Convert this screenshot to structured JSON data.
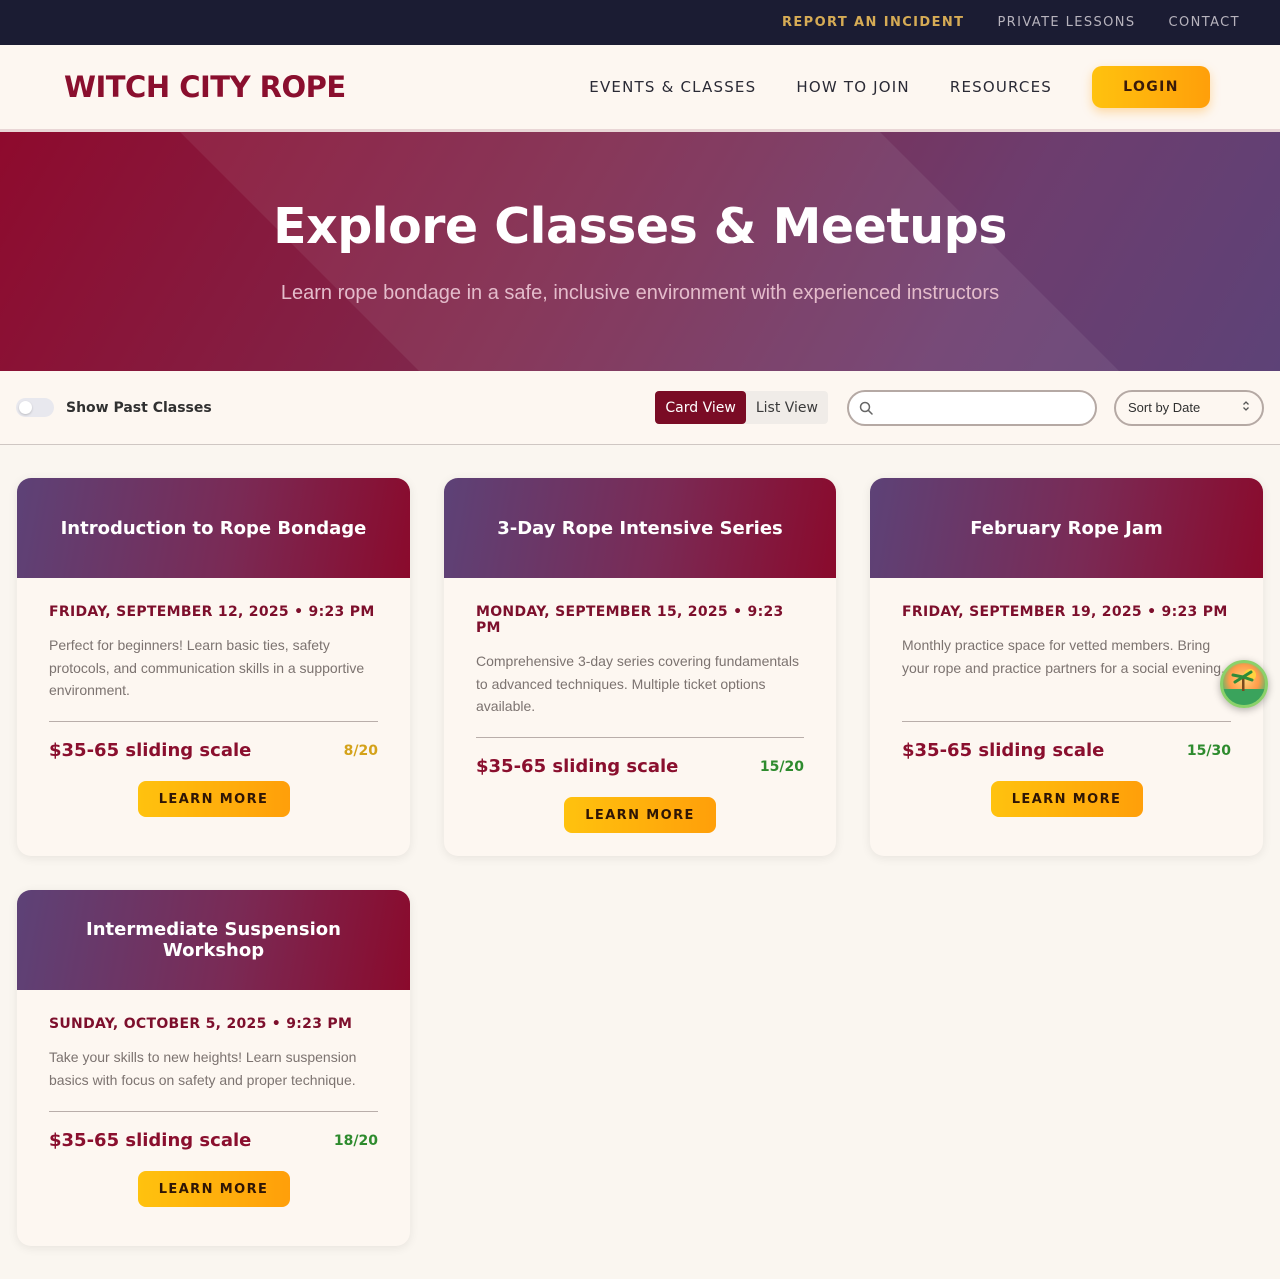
{
  "utility_nav": {
    "report": "REPORT AN INCIDENT",
    "lessons": "PRIVATE LESSONS",
    "contact": "CONTACT"
  },
  "header": {
    "logo": "WITCH CITY ROPE",
    "nav": [
      "EVENTS & CLASSES",
      "HOW TO JOIN",
      "RESOURCES"
    ],
    "login_label": "LOGIN"
  },
  "hero": {
    "title": "Explore Classes & Meetups",
    "subtitle": "Learn rope bondage in a safe, inclusive environment with experienced instructors"
  },
  "filters": {
    "past_toggle_label": "Show Past Classes",
    "past_toggle_on": false,
    "card_view_label": "Card View",
    "list_view_label": "List View",
    "active_view": "card",
    "search_placeholder": "",
    "sort_label": "Sort by Date"
  },
  "events": [
    {
      "title": "Introduction to Rope Bondage",
      "date": "FRIDAY, SEPTEMBER 12, 2025 • 9:23 PM",
      "description": "Perfect for beginners! Learn basic ties, safety protocols, and communication skills in a supportive environment.",
      "price": "$35-65 sliding scale",
      "capacity": "8/20",
      "capacity_color": "#d4a21a",
      "button_label": "LEARN MORE"
    },
    {
      "title": "3-Day Rope Intensive Series",
      "date": "MONDAY, SEPTEMBER 15, 2025 • 9:23 PM",
      "description": "Comprehensive 3-day series covering fundamentals to advanced techniques. Multiple ticket options available.",
      "price": "$35-65 sliding scale",
      "capacity": "15/20",
      "capacity_color": "#2e8b2e",
      "button_label": "LEARN MORE"
    },
    {
      "title": "February Rope Jam",
      "date": "FRIDAY, SEPTEMBER 19, 2025 • 9:23 PM",
      "description": "Monthly practice space for vetted members. Bring your rope and practice partners for a social evening.",
      "price": "$35-65 sliding scale",
      "capacity": "15/30",
      "capacity_color": "#2e8b2e",
      "button_label": "LEARN MORE"
    },
    {
      "title": "Intermediate Suspension Workshop",
      "date": "SUNDAY, OCTOBER 5, 2025 • 9:23 PM",
      "description": "Take your skills to new heights! Learn suspension basics with focus on safety and proper technique.",
      "price": "$35-65 sliding scale",
      "capacity": "18/20",
      "capacity_color": "#2e8b2e",
      "button_label": "LEARN MORE"
    }
  ],
  "colors": {
    "brand": "#8a0f2e",
    "accent": "#ffb20c",
    "topbar": "#1b1c33"
  },
  "icons": {
    "search": "search-icon",
    "sort": "chevron-updown-icon",
    "widget": "floating-assistant-icon"
  }
}
